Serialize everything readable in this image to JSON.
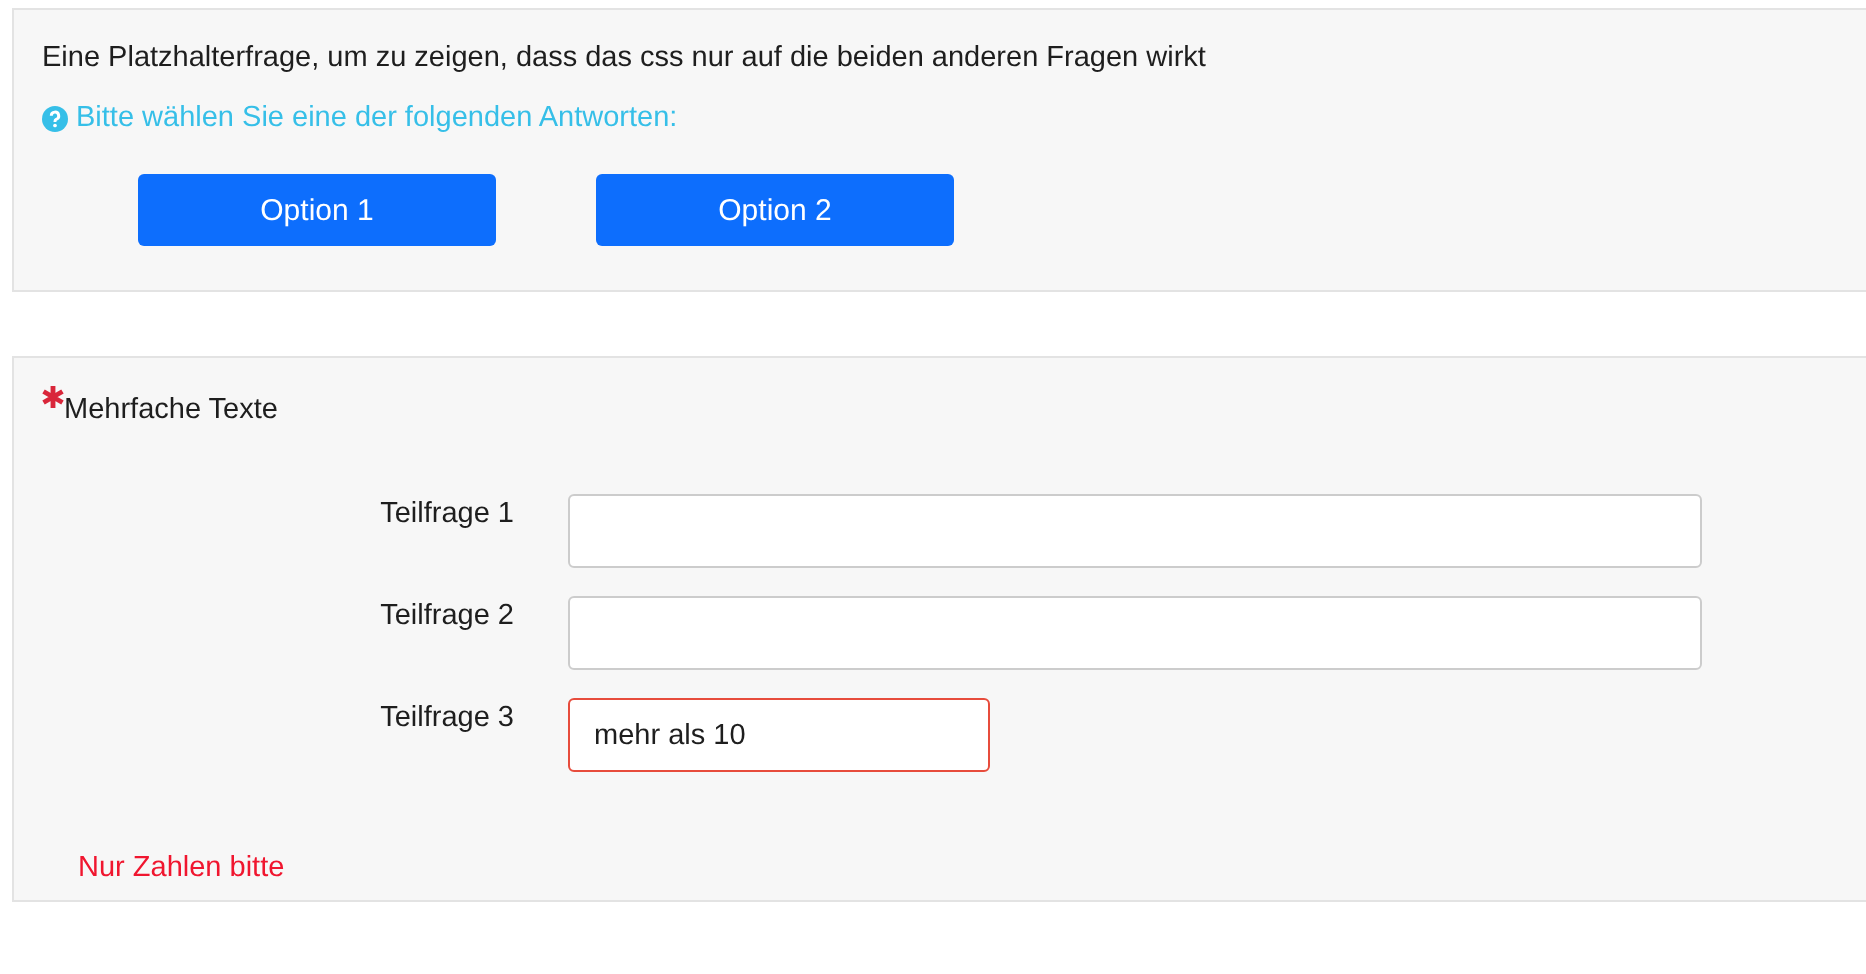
{
  "questions": [
    {
      "kind": "choice",
      "text": "Eine Platzhalterfrage, um zu zeigen, dass das css nur auf die beiden anderen Fragen wirkt",
      "help": "Bitte wählen Sie eine der folgenden Antworten:",
      "options": [
        "Option 1",
        "Option 2"
      ]
    },
    {
      "kind": "multitext",
      "text": "Mehrfache Texte",
      "required": true,
      "subquestions": [
        {
          "label": "Teilfrage 1",
          "kind": "text",
          "invalid": false
        },
        {
          "label": "Teilfrage 2",
          "kind": "text",
          "invalid": false
        },
        {
          "label": "Teilfrage 3",
          "value": "mehr als 10",
          "kind": "number",
          "invalid": true
        }
      ],
      "error": "Nur Zahlen bitte"
    }
  ]
}
